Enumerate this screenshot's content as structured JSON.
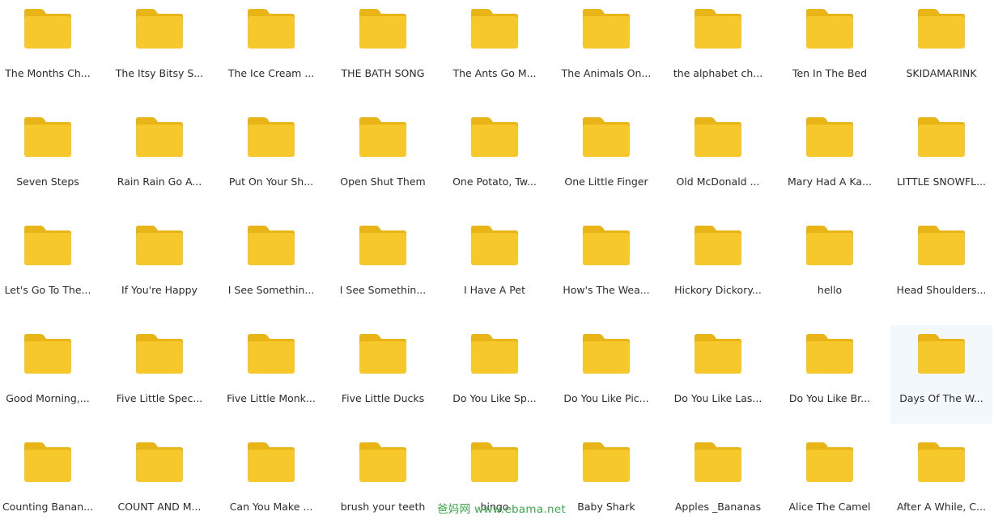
{
  "folder_color": "#f7c82b",
  "folder_tab_color": "#e8b416",
  "selected_bg": "#f3f8fd",
  "folders": [
    {
      "label": "The Months Ch...",
      "selected": false
    },
    {
      "label": "The Itsy Bitsy S...",
      "selected": false
    },
    {
      "label": "The Ice Cream ...",
      "selected": false
    },
    {
      "label": "THE BATH SONG",
      "selected": false
    },
    {
      "label": "The Ants Go M...",
      "selected": false
    },
    {
      "label": "The Animals On...",
      "selected": false
    },
    {
      "label": "the alphabet ch...",
      "selected": false
    },
    {
      "label": "Ten In The Bed",
      "selected": false
    },
    {
      "label": "SKIDAMARINK",
      "selected": false
    },
    {
      "label": "Seven Steps",
      "selected": false
    },
    {
      "label": "Rain Rain Go A...",
      "selected": false
    },
    {
      "label": "Put On Your Sh...",
      "selected": false
    },
    {
      "label": "Open Shut Them",
      "selected": false
    },
    {
      "label": "One Potato, Tw...",
      "selected": false
    },
    {
      "label": "One Little Finger",
      "selected": false
    },
    {
      "label": "Old McDonald ...",
      "selected": false
    },
    {
      "label": "Mary Had A Ka...",
      "selected": false
    },
    {
      "label": "LITTLE SNOWFL...",
      "selected": false
    },
    {
      "label": "Let's Go To The...",
      "selected": false
    },
    {
      "label": "If You're Happy",
      "selected": false
    },
    {
      "label": "I See Somethin...",
      "selected": false
    },
    {
      "label": "I See Somethin...",
      "selected": false
    },
    {
      "label": "I Have A Pet",
      "selected": false
    },
    {
      "label": "How's The Wea...",
      "selected": false
    },
    {
      "label": "Hickory Dickory...",
      "selected": false
    },
    {
      "label": "hello",
      "selected": false
    },
    {
      "label": "Head Shoulders...",
      "selected": false
    },
    {
      "label": "Good Morning,...",
      "selected": false
    },
    {
      "label": "Five Little Spec...",
      "selected": false
    },
    {
      "label": "Five Little Monk...",
      "selected": false
    },
    {
      "label": "Five Little Ducks",
      "selected": false
    },
    {
      "label": "Do You Like Sp...",
      "selected": false
    },
    {
      "label": "Do You Like Pic...",
      "selected": false
    },
    {
      "label": "Do You Like Las...",
      "selected": false
    },
    {
      "label": "Do You Like Br...",
      "selected": false
    },
    {
      "label": "Days Of The W...",
      "selected": true
    },
    {
      "label": "Counting Banan...",
      "selected": false
    },
    {
      "label": "COUNT AND M...",
      "selected": false
    },
    {
      "label": "Can You Make ...",
      "selected": false
    },
    {
      "label": "brush your teeth",
      "selected": false
    },
    {
      "label": "bingo",
      "selected": false
    },
    {
      "label": "Baby Shark",
      "selected": false
    },
    {
      "label": "Apples _Bananas",
      "selected": false
    },
    {
      "label": "Alice The Camel",
      "selected": false
    },
    {
      "label": "After A While, C...",
      "selected": false
    }
  ],
  "watermark": {
    "text": "爸妈网 www.ebama.net",
    "color": "#3aa84a"
  }
}
